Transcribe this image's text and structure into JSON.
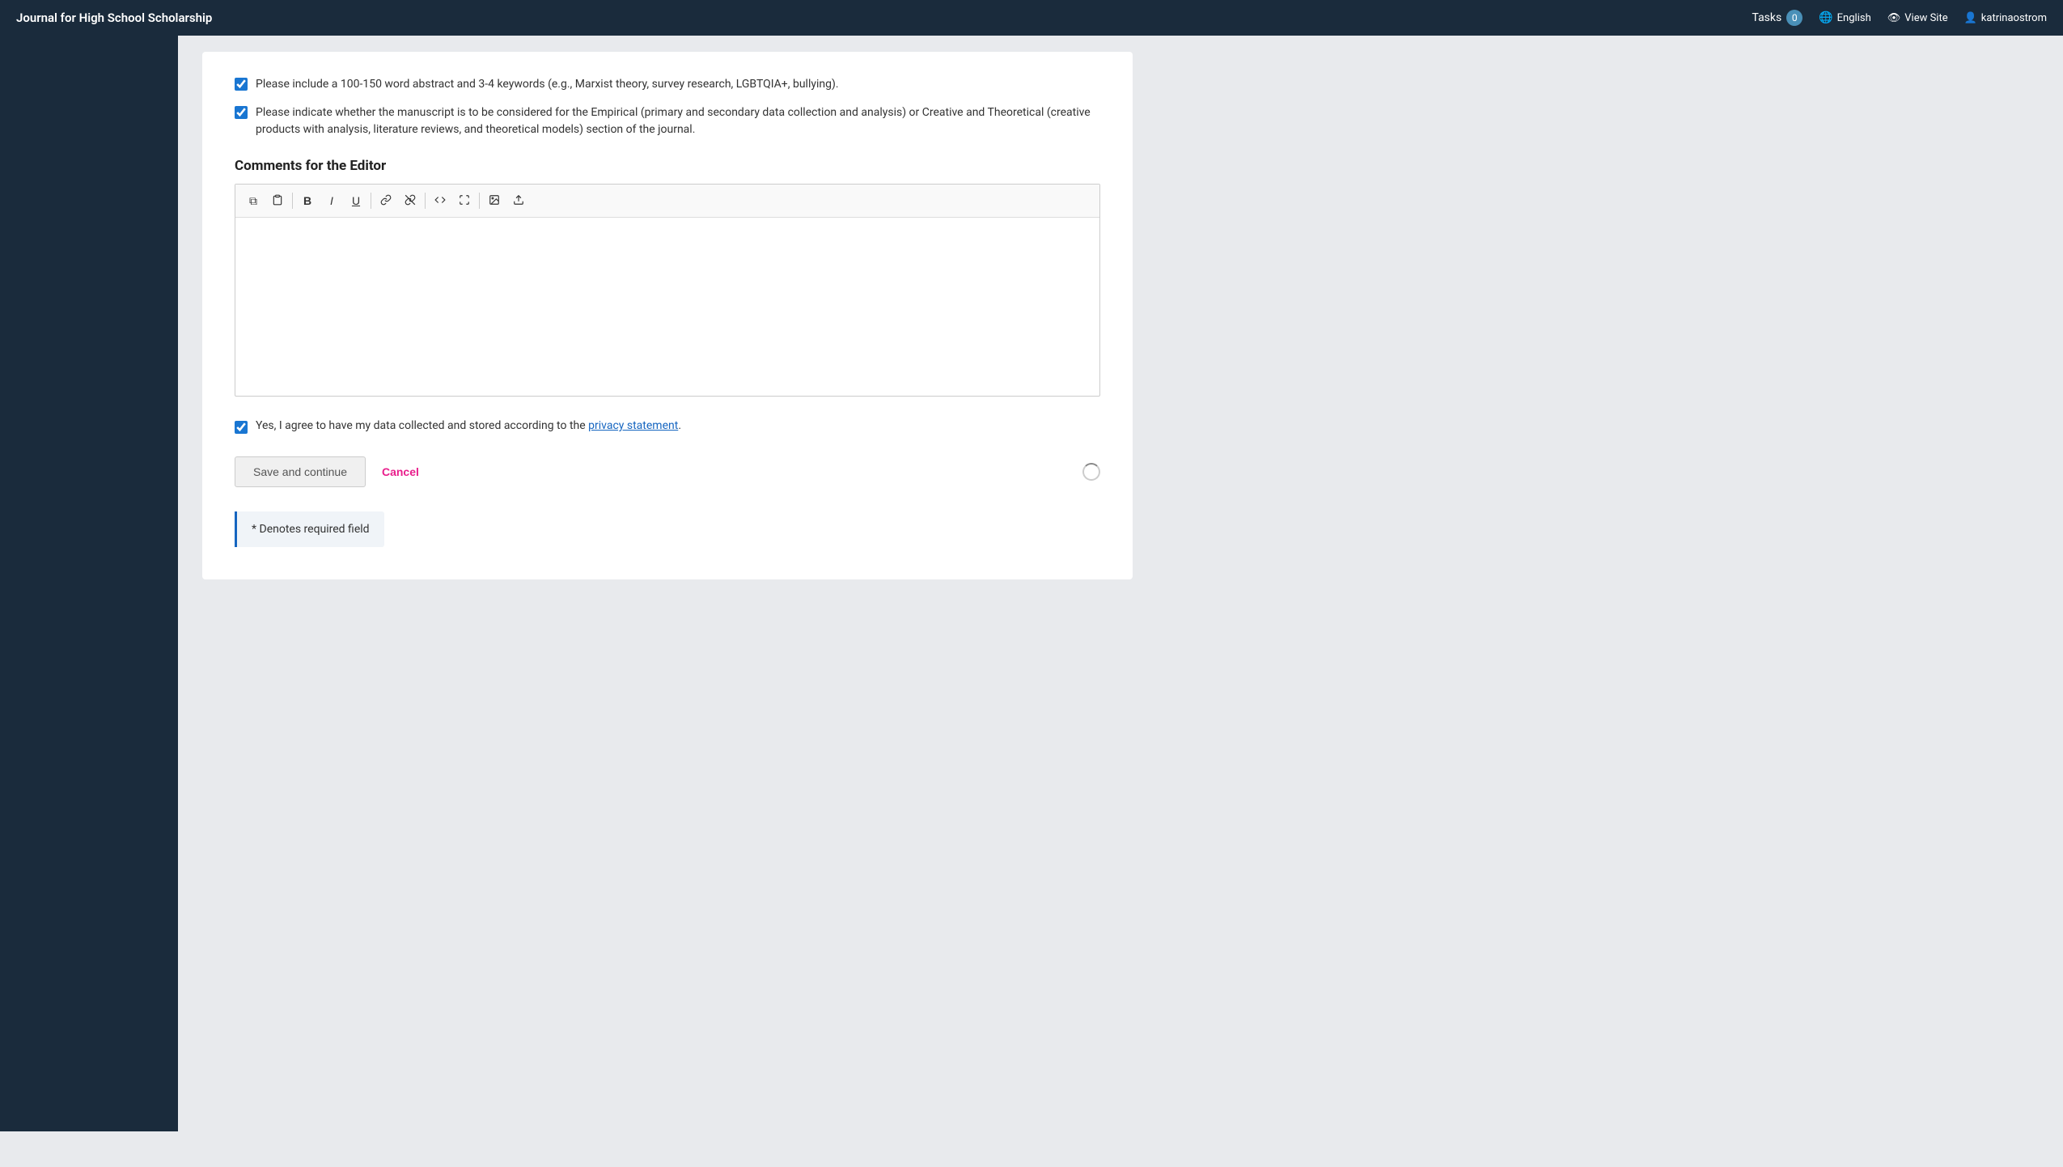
{
  "navbar": {
    "brand": "Journal for High School Scholarship",
    "tasks_label": "Tasks",
    "tasks_count": "0",
    "english_label": "English",
    "view_site_label": "View Site",
    "user_label": "katrinaostrom"
  },
  "checklist": {
    "item1": "Please include a 100-150 word abstract and 3-4 keywords (e.g., Marxist theory, survey research, LGBTQIA+, bullying).",
    "item2": "Please indicate whether the manuscript is to be considered for the Empirical (primary and secondary data collection and analysis) or Creative and Theoretical (creative products with analysis, literature reviews, and theoretical models) section of the journal."
  },
  "editor": {
    "section_title": "Comments for the Editor",
    "toolbar": {
      "copy_title": "Copy",
      "paste_title": "Paste",
      "bold_title": "Bold",
      "italic_title": "Italic",
      "underline_title": "Underline",
      "link_title": "Link",
      "unlink_title": "Unlink",
      "code_title": "Code",
      "fullscreen_title": "Fullscreen",
      "image_title": "Image",
      "upload_title": "Upload"
    },
    "placeholder": ""
  },
  "privacy": {
    "text_before": "Yes, I agree to have my data collected and stored according to the ",
    "link_text": "privacy statement",
    "text_after": "."
  },
  "buttons": {
    "save_label": "Save and continue",
    "cancel_label": "Cancel"
  },
  "required_note": "* Denotes required field",
  "colors": {
    "accent_blue": "#1565c0",
    "cancel_pink": "#e91e8c",
    "navbar_bg": "#1a2b3c"
  }
}
